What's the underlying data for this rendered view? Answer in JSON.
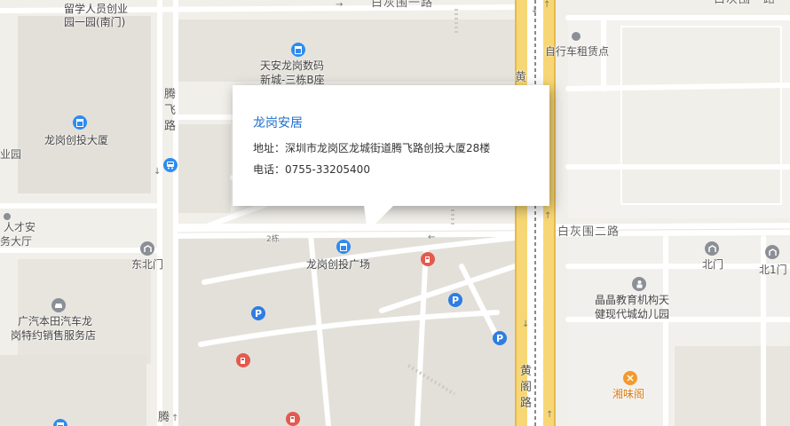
{
  "map": {
    "labels": {
      "school_1": "留学人员创业",
      "school_2": "园一园(南门)",
      "baigaowei_1": "白灰围一路",
      "baigaowei_1_right": "白灰围一路",
      "tianan_1": "天安龙岗数码",
      "tianan_2": "新城-三栋B座",
      "tengfei_top": "腾飞路",
      "chuangtou": "龙岗创投大厦",
      "bike": "自行车租赁点",
      "huang_top": "黄",
      "left_edge": "业园",
      "rencai_1": "人才安",
      "rencai_2": "务大厅",
      "dongbeimen": "东北门",
      "building_2": "2栋",
      "plaza": "龙岗创投广场",
      "baigaowei_2": "白灰围二路",
      "beimen": "北门",
      "beimen1": "北1门",
      "kinder_1": "晶晶教育机构天",
      "kinder_2": "健现代城幼儿园",
      "honda_1": "广汽本田汽车龙",
      "honda_2": "岗特约销售服务店",
      "huangge": "黄阁路",
      "xiangwei": "湘味阁",
      "teng_bottom": "腾"
    },
    "icons": {
      "building": "building-icon",
      "bus": "bus-icon",
      "parking": "parking-icon",
      "restaurant": "restaurant-icon",
      "gas": "gas-station-icon",
      "car": "car-icon",
      "pin": "location-pin-icon"
    },
    "parking_letter": "P"
  },
  "popup": {
    "title": "龙岗安居",
    "address": "地址：深圳市龙岗区龙城街道腾飞路创投大厦28楼",
    "phone": "电话：0755-33205400"
  },
  "colors": {
    "background": "#f1efe9",
    "block": "#e4e1db",
    "major_road": "#f7d775",
    "popup_title": "#1e6ec8",
    "poi_blue": "#2d8cf0",
    "poi_red": "#e35a4f",
    "poi_orange": "#f39a2b"
  }
}
